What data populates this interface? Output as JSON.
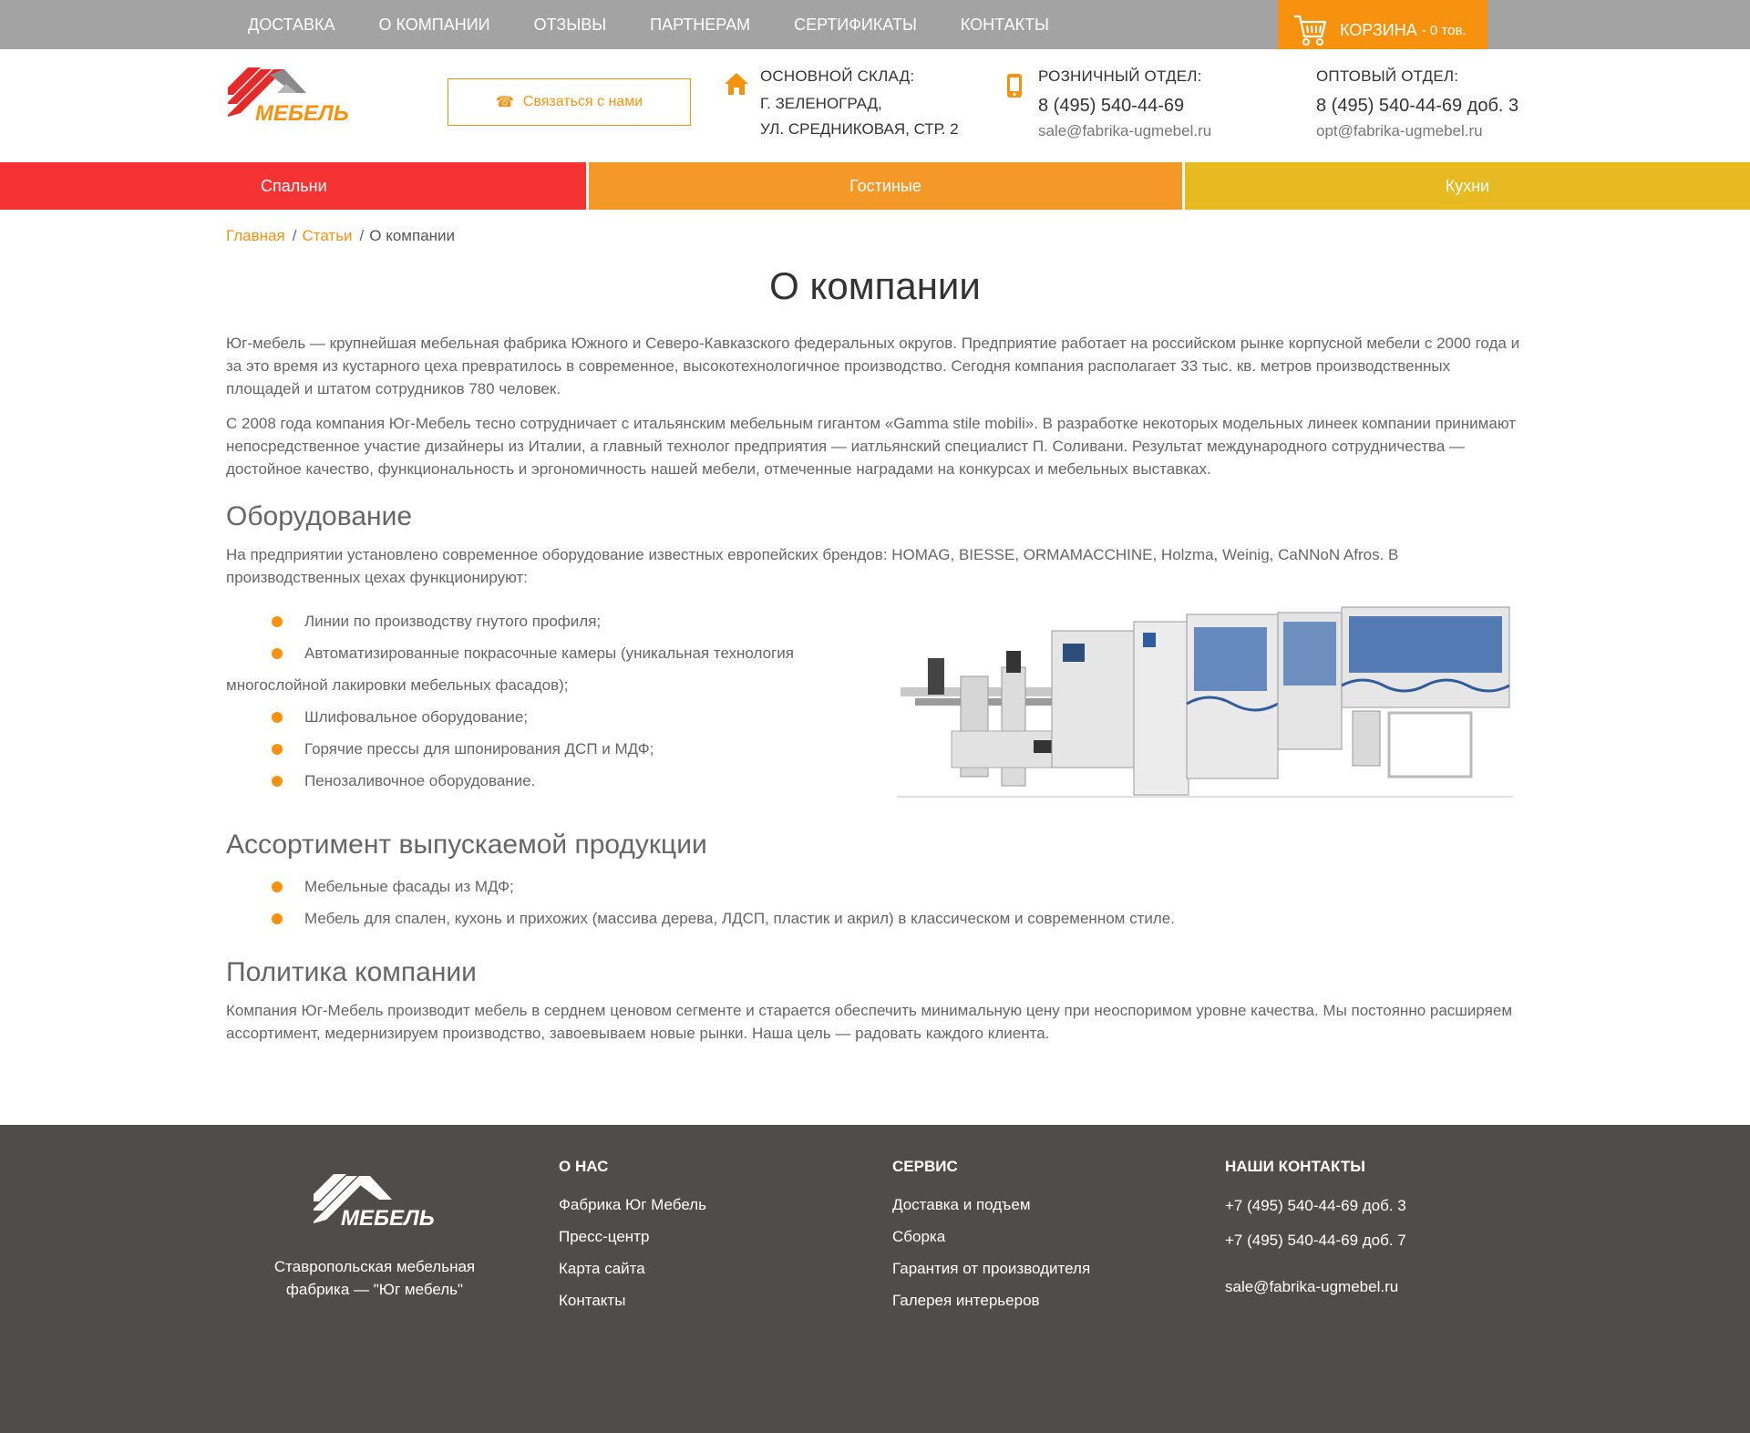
{
  "top_nav": {
    "items": [
      "ДОСТАВКА",
      "О КОМПАНИИ",
      "ОТЗЫВЫ",
      "ПАРТНЕРАМ",
      "СЕРТИФИКАТЫ",
      "КОНТАКТЫ"
    ],
    "cart_label": "КОРЗИНА",
    "cart_count": "- 0 тов."
  },
  "header": {
    "contact_button": "Связаться с нами",
    "warehouse": {
      "caption": "ОСНОВНОЙ СКЛАД:",
      "line1": "Г. ЗЕЛЕНОГРАД,",
      "line2": "УЛ. СРЕДНИКОВАЯ, СТР. 2"
    },
    "retail": {
      "caption": "РОЗНИЧНЫЙ ОТДЕЛ:",
      "phone": "8 (495) 540-44-69",
      "email": "sale@fabrika-ugmebel.ru"
    },
    "wholesale": {
      "caption": "ОПТОВЫЙ ОТДЕЛ:",
      "phone": "8 (495) 540-44-69 доб. 3",
      "email": "opt@fabrika-ugmebel.ru"
    }
  },
  "categories": [
    "Спальни",
    "Гостиные",
    "Кухни"
  ],
  "breadcrumbs": {
    "home": "Главная",
    "articles": "Статьи",
    "current": "О компании"
  },
  "page": {
    "title": "О компании",
    "intro1": "Юг-мебель — крупнейшая мебельная фабрика Южного и Северо-Кавказского федеральных округов. Предприятие работает на российском рынке корпусной мебели с 2000 года и за это время из кустарного цеха превратилось в современное, высокотехнологичное производство. Сегодня компания располагает 33 тыс. кв. метров производственных площадей и штатом сотрудников 780 человек.",
    "intro2": "С 2008 года компания Юг-Мебель тесно сотрудничает с итальянским мебельным гигантом «Gamma stile mobili». В разработке некоторых модельных линеек компании принимают непосредственное участие дизайнеры из Италии, а главный технолог предприятия — иатльянский специалист П. Соливани. Результат международного сотрудничества — достойное качество, функциональность и эргономичность нашей мебели, отмеченные наградами на конкурсах и мебельных выставках.",
    "equipment_heading": "Оборудование",
    "equipment_text": "На предприятии установлено современное оборудование известных европейских брендов: HOMAG, BIESSE, ORMAMACCHINE, Holzma, Weinig, CaNNoN Afros. В производственных цехах функционируют:",
    "equipment_list": [
      "Линии по производству гнутого профиля;",
      "Автоматизированные покрасочные камеры (уникальная технология многослойной лакировки мебельных фасадов);",
      "Шлифовальное оборудование;",
      "Горячие прессы для шпонирования ДСП и МДФ;",
      "Пенозаливочное оборудование."
    ],
    "assortment_heading": "Ассортимент выпускаемой продукции",
    "assortment_list": [
      "Мебельные фасады из МДФ;",
      "Мебель для спален, кухонь и прихожих (массива дерева, ЛДСП, пластик и акрил) в классическом и современном стиле."
    ],
    "policy_heading": "Политика компании",
    "policy_text": "Компания Юг-Мебель производит мебель в серднем ценовом сегменте и старается обеспечить минимальную цену при неоспоримом уровне качества. Мы постоянно расширяем ассортимент, медернизируем производство, завоевываем новые рынки. Наша цель — радовать каждого клиента."
  },
  "footer": {
    "tagline": "Ставропольская мебельная фабрика — \"Юг мебель\"",
    "about": {
      "heading": "О НАС",
      "links": [
        "Фабрика Юг Мебель",
        "Пресс-центр",
        "Карта сайта",
        "Контакты"
      ]
    },
    "service": {
      "heading": "СЕРВИС",
      "links": [
        "Доставка и подъем",
        "Сборка",
        "Гарантия от производителя",
        "Галерея интерьеров"
      ]
    },
    "contacts": {
      "heading": "НАШИ КОНТАКТЫ",
      "phone1": "+7 (495) 540-44-69 доб. 3",
      "phone2": "+7 (495) 540-44-69 доб. 7",
      "email": "sale@fabrika-ugmebel.ru"
    }
  },
  "colors": {
    "accent": "#f7920f",
    "topbar": "#a3a3a3",
    "cat_bedrooms": "#f63333",
    "cat_living": "#f49928",
    "cat_kitchens": "#e8ba22",
    "footer": "#4f4d4b"
  },
  "icons": [
    "cart-icon",
    "phone-icon",
    "house-icon",
    "mobile-phone-icon",
    "bullet-dot-icon"
  ]
}
